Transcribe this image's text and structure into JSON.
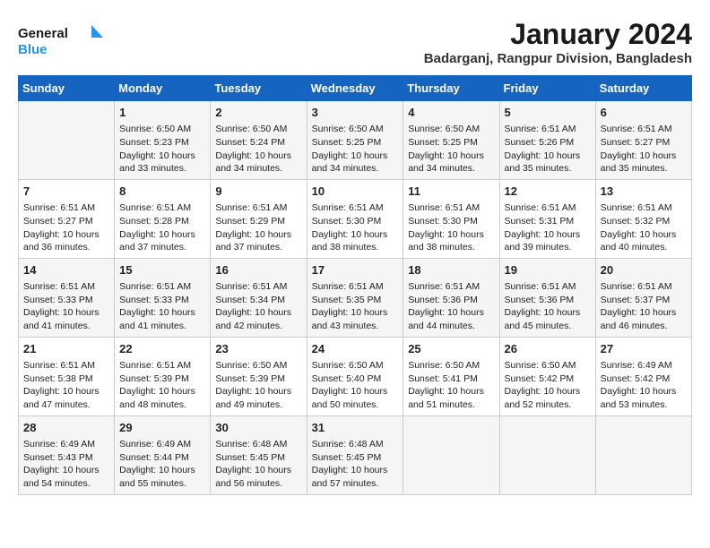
{
  "logo": {
    "line1": "General",
    "line2": "Blue"
  },
  "title": "January 2024",
  "subtitle": "Badarganj, Rangpur Division, Bangladesh",
  "weekdays": [
    "Sunday",
    "Monday",
    "Tuesday",
    "Wednesday",
    "Thursday",
    "Friday",
    "Saturday"
  ],
  "weeks": [
    [
      {
        "day": "",
        "info": ""
      },
      {
        "day": "1",
        "info": "Sunrise: 6:50 AM\nSunset: 5:23 PM\nDaylight: 10 hours\nand 33 minutes."
      },
      {
        "day": "2",
        "info": "Sunrise: 6:50 AM\nSunset: 5:24 PM\nDaylight: 10 hours\nand 34 minutes."
      },
      {
        "day": "3",
        "info": "Sunrise: 6:50 AM\nSunset: 5:25 PM\nDaylight: 10 hours\nand 34 minutes."
      },
      {
        "day": "4",
        "info": "Sunrise: 6:50 AM\nSunset: 5:25 PM\nDaylight: 10 hours\nand 34 minutes."
      },
      {
        "day": "5",
        "info": "Sunrise: 6:51 AM\nSunset: 5:26 PM\nDaylight: 10 hours\nand 35 minutes."
      },
      {
        "day": "6",
        "info": "Sunrise: 6:51 AM\nSunset: 5:27 PM\nDaylight: 10 hours\nand 35 minutes."
      }
    ],
    [
      {
        "day": "7",
        "info": "Sunrise: 6:51 AM\nSunset: 5:27 PM\nDaylight: 10 hours\nand 36 minutes."
      },
      {
        "day": "8",
        "info": "Sunrise: 6:51 AM\nSunset: 5:28 PM\nDaylight: 10 hours\nand 37 minutes."
      },
      {
        "day": "9",
        "info": "Sunrise: 6:51 AM\nSunset: 5:29 PM\nDaylight: 10 hours\nand 37 minutes."
      },
      {
        "day": "10",
        "info": "Sunrise: 6:51 AM\nSunset: 5:30 PM\nDaylight: 10 hours\nand 38 minutes."
      },
      {
        "day": "11",
        "info": "Sunrise: 6:51 AM\nSunset: 5:30 PM\nDaylight: 10 hours\nand 38 minutes."
      },
      {
        "day": "12",
        "info": "Sunrise: 6:51 AM\nSunset: 5:31 PM\nDaylight: 10 hours\nand 39 minutes."
      },
      {
        "day": "13",
        "info": "Sunrise: 6:51 AM\nSunset: 5:32 PM\nDaylight: 10 hours\nand 40 minutes."
      }
    ],
    [
      {
        "day": "14",
        "info": "Sunrise: 6:51 AM\nSunset: 5:33 PM\nDaylight: 10 hours\nand 41 minutes."
      },
      {
        "day": "15",
        "info": "Sunrise: 6:51 AM\nSunset: 5:33 PM\nDaylight: 10 hours\nand 41 minutes."
      },
      {
        "day": "16",
        "info": "Sunrise: 6:51 AM\nSunset: 5:34 PM\nDaylight: 10 hours\nand 42 minutes."
      },
      {
        "day": "17",
        "info": "Sunrise: 6:51 AM\nSunset: 5:35 PM\nDaylight: 10 hours\nand 43 minutes."
      },
      {
        "day": "18",
        "info": "Sunrise: 6:51 AM\nSunset: 5:36 PM\nDaylight: 10 hours\nand 44 minutes."
      },
      {
        "day": "19",
        "info": "Sunrise: 6:51 AM\nSunset: 5:36 PM\nDaylight: 10 hours\nand 45 minutes."
      },
      {
        "day": "20",
        "info": "Sunrise: 6:51 AM\nSunset: 5:37 PM\nDaylight: 10 hours\nand 46 minutes."
      }
    ],
    [
      {
        "day": "21",
        "info": "Sunrise: 6:51 AM\nSunset: 5:38 PM\nDaylight: 10 hours\nand 47 minutes."
      },
      {
        "day": "22",
        "info": "Sunrise: 6:51 AM\nSunset: 5:39 PM\nDaylight: 10 hours\nand 48 minutes."
      },
      {
        "day": "23",
        "info": "Sunrise: 6:50 AM\nSunset: 5:39 PM\nDaylight: 10 hours\nand 49 minutes."
      },
      {
        "day": "24",
        "info": "Sunrise: 6:50 AM\nSunset: 5:40 PM\nDaylight: 10 hours\nand 50 minutes."
      },
      {
        "day": "25",
        "info": "Sunrise: 6:50 AM\nSunset: 5:41 PM\nDaylight: 10 hours\nand 51 minutes."
      },
      {
        "day": "26",
        "info": "Sunrise: 6:50 AM\nSunset: 5:42 PM\nDaylight: 10 hours\nand 52 minutes."
      },
      {
        "day": "27",
        "info": "Sunrise: 6:49 AM\nSunset: 5:42 PM\nDaylight: 10 hours\nand 53 minutes."
      }
    ],
    [
      {
        "day": "28",
        "info": "Sunrise: 6:49 AM\nSunset: 5:43 PM\nDaylight: 10 hours\nand 54 minutes."
      },
      {
        "day": "29",
        "info": "Sunrise: 6:49 AM\nSunset: 5:44 PM\nDaylight: 10 hours\nand 55 minutes."
      },
      {
        "day": "30",
        "info": "Sunrise: 6:48 AM\nSunset: 5:45 PM\nDaylight: 10 hours\nand 56 minutes."
      },
      {
        "day": "31",
        "info": "Sunrise: 6:48 AM\nSunset: 5:45 PM\nDaylight: 10 hours\nand 57 minutes."
      },
      {
        "day": "",
        "info": ""
      },
      {
        "day": "",
        "info": ""
      },
      {
        "day": "",
        "info": ""
      }
    ]
  ]
}
